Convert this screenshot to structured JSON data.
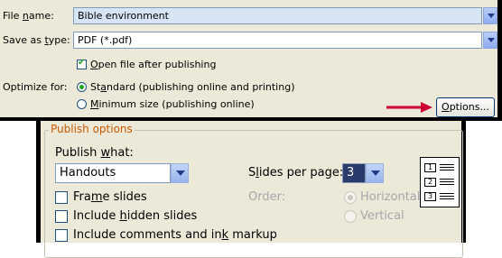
{
  "save_dialog": {
    "file_name_label": "File name:",
    "file_name_value": "Bible environment",
    "save_type_label": "Save as type:",
    "save_type_value": "PDF (*.pdf)",
    "open_after_label": "Open file after publishing",
    "open_after_checked": true,
    "optimize_label": "Optimize for:",
    "standard_label": "Standard (publishing online and printing)",
    "minimum_label": "Minimum size (publishing online)",
    "selected_optimize": "standard",
    "options_button": "Options...",
    "arrow_color": "#cc0033"
  },
  "publish_options": {
    "group_title": "Publish options",
    "publish_what_label": "Publish what:",
    "publish_what_value": "Handouts",
    "slides_per_page_label": "Slides per page:",
    "slides_per_page_value": "3",
    "order_label": "Order:",
    "horizontal_label": "Horizontal",
    "vertical_label": "Vertical",
    "frame_slides_label": "Frame slides",
    "hidden_slides_label": "Include hidden slides",
    "comments_label": "Include comments and ink markup",
    "preview_numbers": [
      "1",
      "2",
      "3"
    ]
  }
}
